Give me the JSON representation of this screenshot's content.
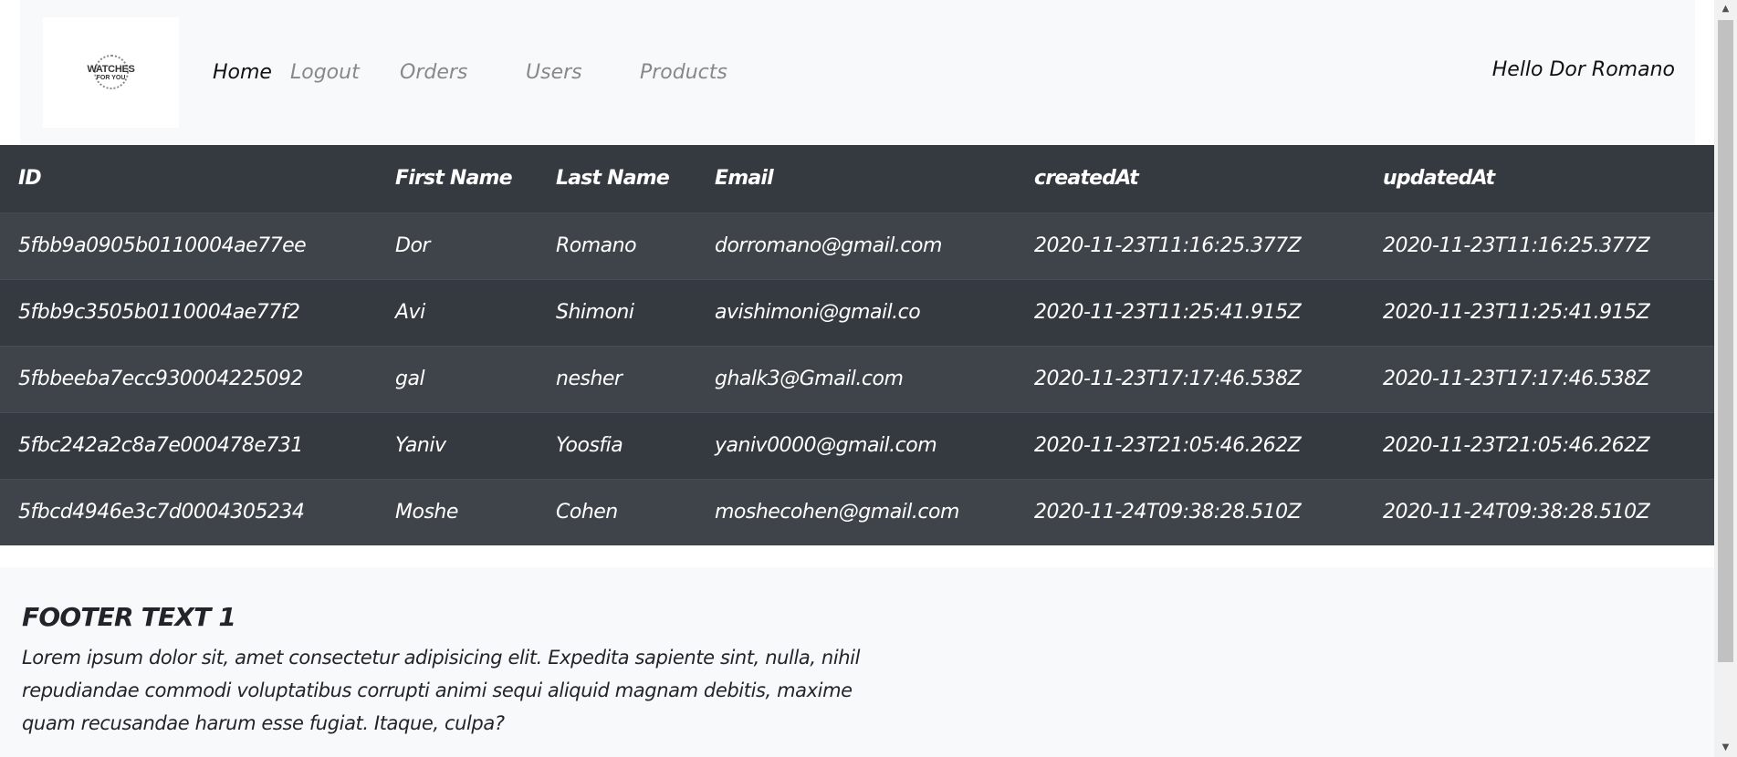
{
  "navbar": {
    "logo": {
      "line1": "WATCHES",
      "line2": "FOR YOU"
    },
    "links": [
      {
        "label": "Home",
        "active": true
      },
      {
        "label": "Logout",
        "active": false
      },
      {
        "label": "Orders",
        "active": false
      },
      {
        "label": "Users",
        "active": false
      },
      {
        "label": "Products",
        "active": false
      }
    ],
    "greeting": "Hello Dor Romano"
  },
  "users_table": {
    "headers": [
      "ID",
      "First Name",
      "Last Name",
      "Email",
      "createdAt",
      "updatedAt"
    ],
    "rows": [
      [
        "5fbb9a0905b0110004ae77ee",
        "Dor",
        "Romano",
        "dorromano@gmail.com",
        "2020-11-23T11:16:25.377Z",
        "2020-11-23T11:16:25.377Z"
      ],
      [
        "5fbb9c3505b0110004ae77f2",
        "Avi",
        "Shimoni",
        "avishimoni@gmail.co",
        "2020-11-23T11:25:41.915Z",
        "2020-11-23T11:25:41.915Z"
      ],
      [
        "5fbbeeba7ecc930004225092",
        "gal",
        "nesher",
        "ghalk3@Gmail.com",
        "2020-11-23T17:17:46.538Z",
        "2020-11-23T17:17:46.538Z"
      ],
      [
        "5fbc242a2c8a7e000478e731",
        "Yaniv",
        "Yoosfia",
        "yaniv0000@gmail.com",
        "2020-11-23T21:05:46.262Z",
        "2020-11-23T21:05:46.262Z"
      ],
      [
        "5fbcd4946e3c7d0004305234",
        "Moshe",
        "Cohen",
        "moshecohen@gmail.com",
        "2020-11-24T09:38:28.510Z",
        "2020-11-24T09:38:28.510Z"
      ]
    ]
  },
  "footer": {
    "title": "FOOTER TEXT 1",
    "text": "Lorem ipsum dolor sit, amet consectetur adipisicing elit. Expedita sapiente sint, nulla, nihil repudiandae commodi voluptatibus corrupti animi sequi aliquid magnam debitis, maxime quam recusandae harum esse fugiat. Itaque, culpa?"
  },
  "colors": {
    "navbar_bg": "#f8f9fa",
    "table_dark": "#343a40",
    "table_striped": "#3e444a",
    "nav_active": "#111111",
    "nav_inactive": "#888888"
  },
  "icons": {
    "scroll_up": "scroll-up-arrow-icon",
    "scroll_down": "scroll-down-arrow-icon"
  }
}
